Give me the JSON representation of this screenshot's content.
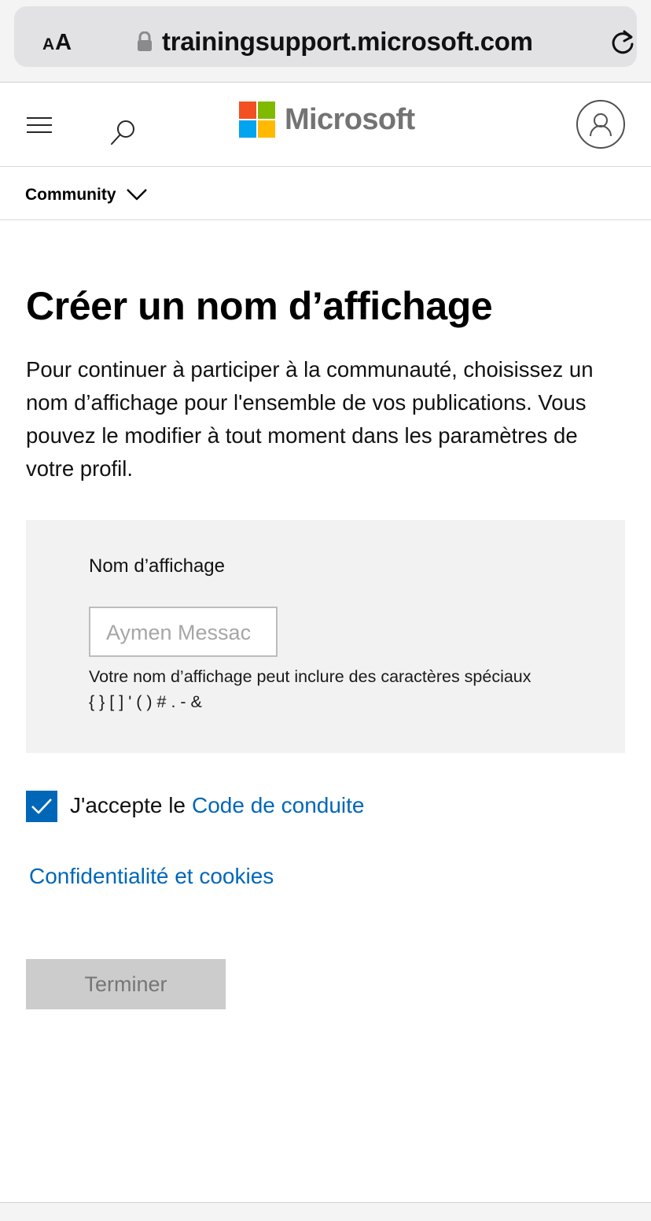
{
  "browser": {
    "text_size_small": "A",
    "text_size_big": "A",
    "url": "trainingsupport.microsoft.com"
  },
  "header": {
    "brand": "Microsoft",
    "logo_colors": [
      "#f25022",
      "#7fba00",
      "#00a4ef",
      "#ffb900"
    ]
  },
  "nav": {
    "community_label": "Community"
  },
  "main": {
    "title": "Créer un nom d’affichage",
    "intro": "Pour continuer à participer à la communauté, choisissez un nom d’affichage pour l'ensemble de vos publications. Vous pouvez le modifier à tout moment dans les paramètres de votre profil.",
    "field_label": "Nom d’affichage",
    "input_placeholder": "Aymen Messac",
    "hint_line1": "Votre nom d’affichage peut inclure des caractères spéciaux",
    "hint_line2": "{ } [ ] ' ( ) # . - &",
    "checkbox_checked": true,
    "accept_text": "J'accepte le",
    "accept_link": "Code de conduite",
    "privacy_link": "Confidentialité et cookies",
    "finish_button": "Terminer"
  },
  "colors": {
    "accent": "#0067b8",
    "form_background": "#f2f2f2",
    "disabled_button": "#cccccc"
  }
}
